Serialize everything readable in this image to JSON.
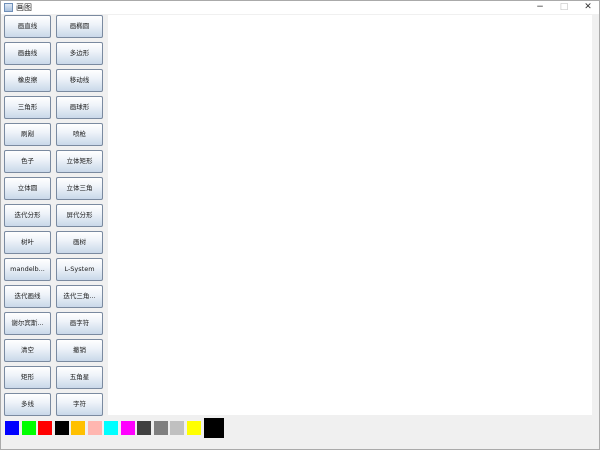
{
  "window": {
    "title": "画图",
    "controls": {
      "minimize": "−",
      "maximize": "□",
      "close": "✕"
    },
    "icon": "app-icon"
  },
  "tools": [
    [
      "画直线",
      "画椭圆"
    ],
    [
      "画曲线",
      "多边形"
    ],
    [
      "橡皮擦",
      "移动线"
    ],
    [
      "三角形",
      "画球形"
    ],
    [
      "刷剐",
      "喷枪"
    ],
    [
      "色子",
      "立体矩形"
    ],
    [
      "立体圆",
      "立体三角"
    ],
    [
      "迭代分形",
      "屏代分形"
    ],
    [
      "树叶",
      "画树"
    ],
    [
      "mandelb...",
      "L-System"
    ],
    [
      "迭代画线",
      "迭代三角..."
    ],
    [
      "谢尔宾斯...",
      "画字符"
    ],
    [
      "清空",
      "撤销"
    ],
    [
      "矩形",
      "五角星"
    ],
    [
      "多线",
      "字符"
    ]
  ],
  "palette": {
    "colors": [
      "#0000ff",
      "#00ff00",
      "#ff0000",
      "#000000",
      "#ffc000",
      "#ffb6b0",
      "#00ffff",
      "#ff00ff",
      "#404040",
      "#808080",
      "#c0c0c0",
      "#ffff00"
    ],
    "current": "#000000"
  }
}
